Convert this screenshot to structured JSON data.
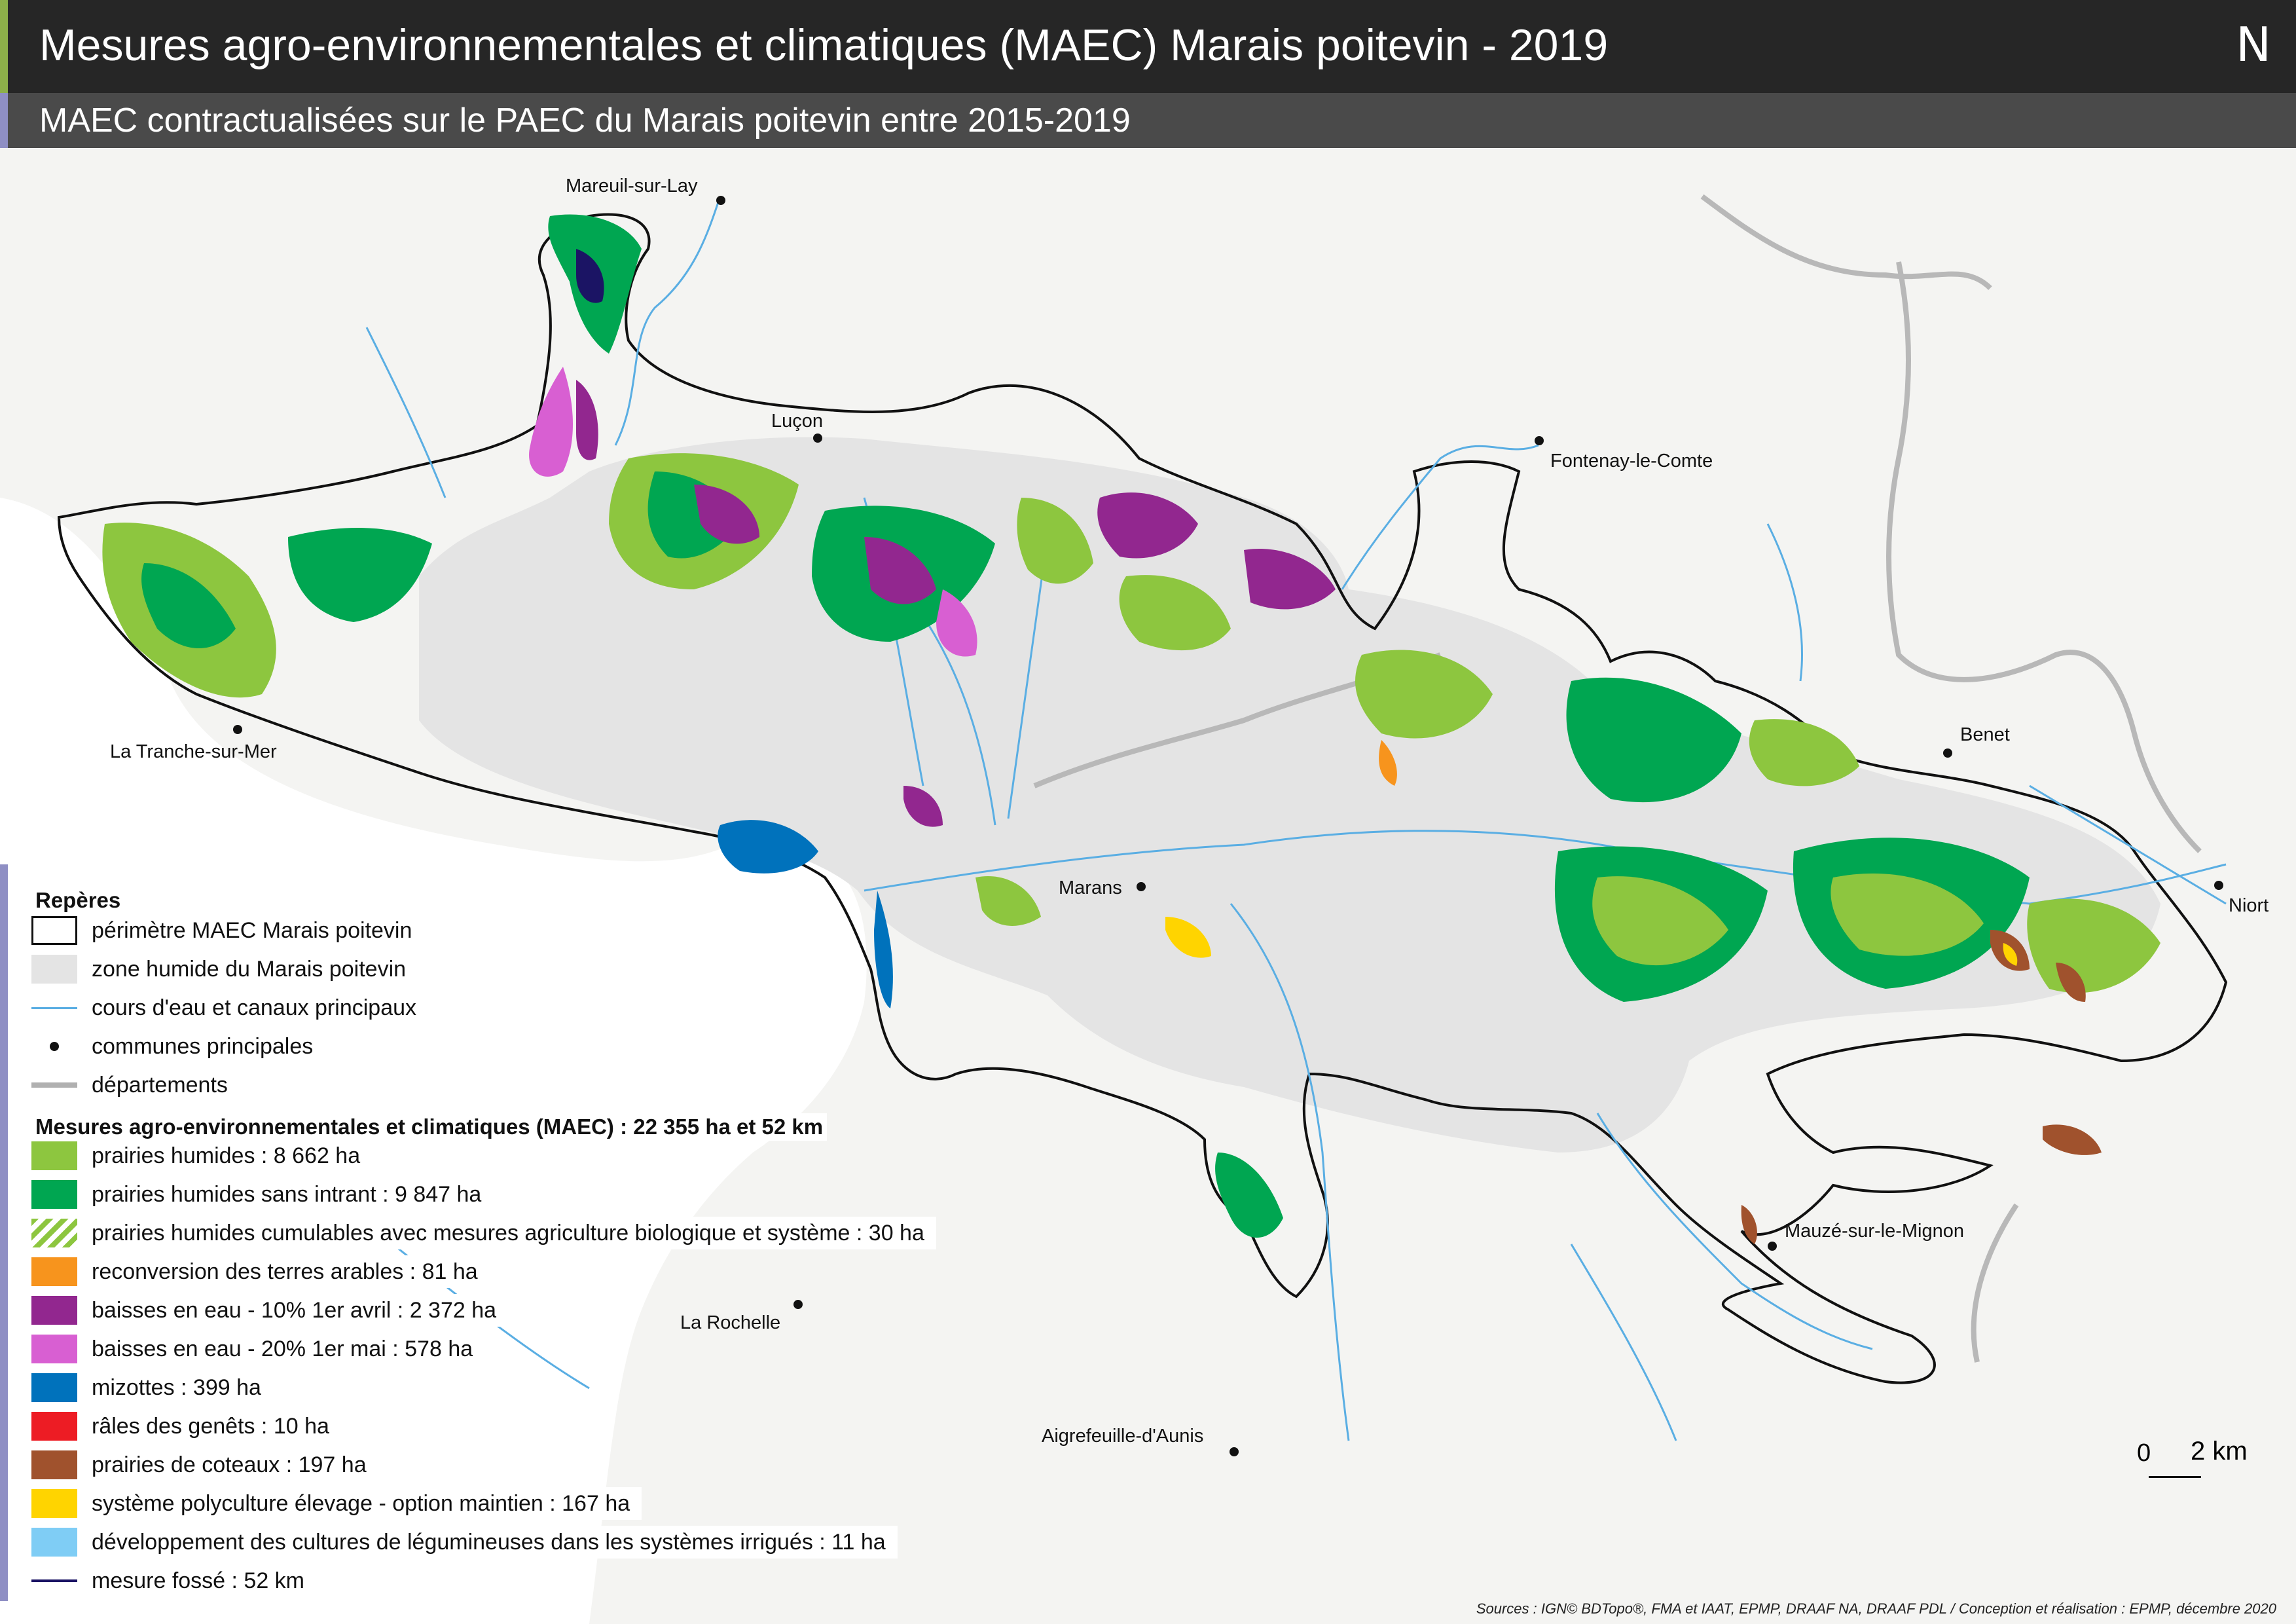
{
  "header": {
    "title": "Mesures agro-environnementales et climatiques (MAEC) Marais poitevin - 2019",
    "north_label": "N",
    "subtitle": "MAEC contractualisées sur le PAEC du Marais poitevin entre 2015-2019"
  },
  "places": [
    {
      "name": "Mareuil-sur-Lay"
    },
    {
      "name": "Luçon"
    },
    {
      "name": "Fontenay-le-Comte"
    },
    {
      "name": "La Tranche-sur-Mer"
    },
    {
      "name": "Benet"
    },
    {
      "name": "Marans"
    },
    {
      "name": "Niort"
    },
    {
      "name": "Mauzé-sur-le-Mignon"
    },
    {
      "name": "La Rochelle"
    },
    {
      "name": "Aigrefeuille-d'Aunis"
    }
  ],
  "legend": {
    "reperes_title": "Repères",
    "reperes": [
      {
        "label": "périmètre MAEC Marais poitevin",
        "color": "#ffffff",
        "kind": "outline"
      },
      {
        "label": "zone humide du Marais poitevin",
        "color": "#e4e4e4",
        "kind": "fill"
      },
      {
        "label": "cours d'eau et canaux principaux",
        "color": "#5aaee3",
        "kind": "line"
      },
      {
        "label": "communes principales",
        "color": "#111111",
        "kind": "dot"
      },
      {
        "label": "départements",
        "color": "#b0b0b0",
        "kind": "thickline"
      }
    ],
    "maec_title": "Mesures agro-environnementales et climatiques (MAEC) : 22 355 ha et 52 km",
    "maec": [
      {
        "label": "prairies humides : 8 662 ha",
        "color": "#8dc63f",
        "kind": "fill"
      },
      {
        "label": "prairies humides sans intrant : 9 847 ha",
        "color": "#00a651",
        "kind": "fill"
      },
      {
        "label": "prairies humides cumulables avec mesures agriculture biologique et système : 30 ha",
        "color": "#8dc63f",
        "kind": "hatch"
      },
      {
        "label": "reconversion des terres arables : 81 ha",
        "color": "#f7941d",
        "kind": "fill"
      },
      {
        "label": "baisses en eau - 10% 1er avril : 2 372 ha",
        "color": "#92278f",
        "kind": "fill"
      },
      {
        "label": "baisses en eau - 20% 1er mai : 578 ha",
        "color": "#d85fd2",
        "kind": "fill"
      },
      {
        "label": "mizottes : 399 ha",
        "color": "#0072bc",
        "kind": "fill"
      },
      {
        "label": "râles des genêts : 10 ha",
        "color": "#ed1c24",
        "kind": "fill"
      },
      {
        "label": "prairies de coteaux : 197 ha",
        "color": "#a0522d",
        "kind": "fill"
      },
      {
        "label": "système polyculture élevage - option maintien : 167 ha",
        "color": "#ffd400",
        "kind": "fill"
      },
      {
        "label": "développement des cultures de légumineuses dans les systèmes irrigués : 11 ha",
        "color": "#7fcdf5",
        "kind": "fill"
      },
      {
        "label": "mesure fossé : 52 km",
        "color": "#1b1464",
        "kind": "line"
      }
    ]
  },
  "scale": {
    "zero": "0",
    "distance": "2 km"
  },
  "sources": "Sources : IGN© BDTopo®, FMA et IAAT, EPMP, DRAAF NA, DRAAF PDL / Conception et réalisation : EPMP, décembre 2020"
}
